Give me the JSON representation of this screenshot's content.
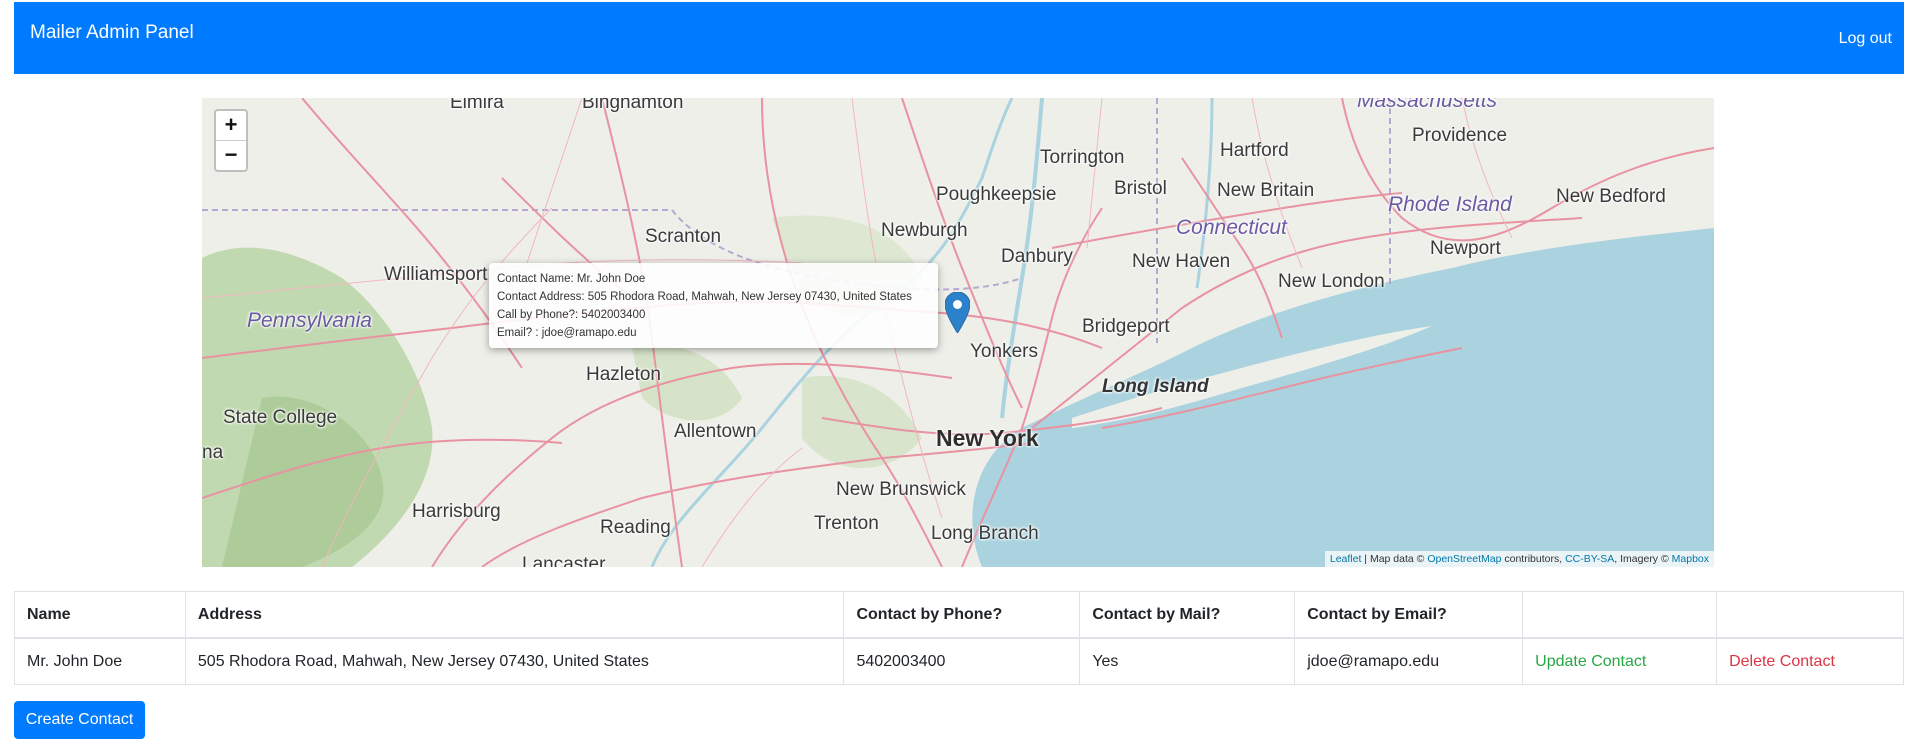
{
  "navbar": {
    "brand": "Mailer Admin Panel",
    "logout_label": "Log out",
    "color": "#007bff"
  },
  "map": {
    "zoom_in_label": "+",
    "zoom_out_label": "−",
    "places": [
      "Elmira",
      "Binghamton",
      "Massachusetts",
      "Torrington",
      "Hartford",
      "Providence",
      "Poughkeepsie",
      "Bristol",
      "New Britain",
      "Rhode Island",
      "New Bedford",
      "Connecticut",
      "Scranton",
      "Newburgh",
      "Newport",
      "Danbury",
      "New Haven",
      "Williamsport",
      "New London",
      "Pennsylvania",
      "Bridgeport",
      "Yonkers",
      "Hazleton",
      "Long Island",
      "State College",
      "Allentown",
      "New York",
      "na",
      "New Brunswick",
      "Harrisburg",
      "Reading",
      "Trenton",
      "Long Branch",
      "Lancaster"
    ],
    "popup": {
      "name_line": "Contact Name: Mr. John Doe",
      "address_line": "Contact Address: 505 Rhodora Road, Mahwah, New Jersey 07430, United States",
      "phone_line": "Call by Phone?: 5402003400",
      "email_line": "Email? : jdoe@ramapo.edu"
    },
    "attribution": {
      "leaflet": "Leaflet",
      "sep1": " | Map data © ",
      "osm": "OpenStreetMap",
      "sep2": " contributors, ",
      "license": "CC-BY-SA",
      "sep3": ", Imagery © ",
      "mapbox": "Mapbox"
    }
  },
  "table": {
    "headers": [
      "Name",
      "Address",
      "Contact by Phone?",
      "Contact by Mail?",
      "Contact by Email?",
      "",
      ""
    ],
    "rows": [
      {
        "name": "Mr. John Doe",
        "address": "505 Rhodora Road, Mahwah, New Jersey 07430, United States",
        "phone": "5402003400",
        "mail": "Yes",
        "email": "jdoe@ramapo.edu",
        "update_label": "Update Contact",
        "delete_label": "Delete Contact"
      }
    ]
  },
  "create_button_label": "Create Contact",
  "colors": {
    "primary": "#007bff",
    "success": "#28a745",
    "danger": "#dc3545",
    "water": "#aad3df"
  }
}
